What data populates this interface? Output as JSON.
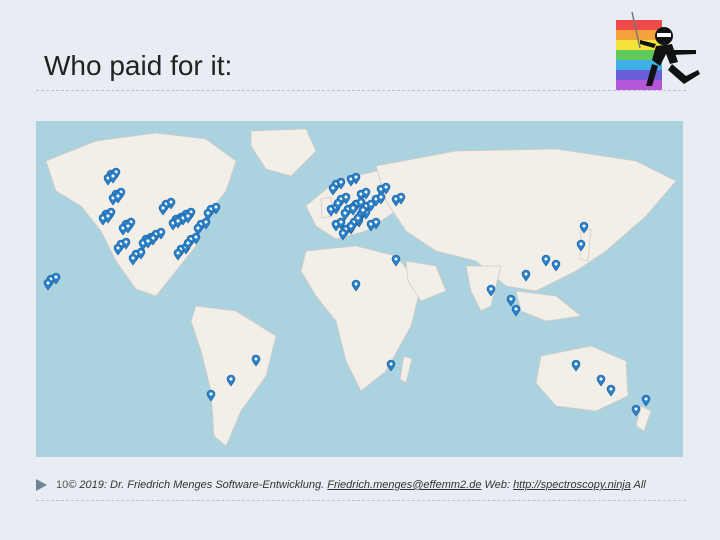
{
  "slide": {
    "title": "Who paid for it:"
  },
  "footer": {
    "page_number": "10",
    "copyright": "© 2019:  Dr. Friedrich Menges Software-Entwicklung.",
    "email": "Friedrich.menges@effemm2.de",
    "web_label": " Web: ",
    "web_url": "http://spectroscopy.ninja",
    "trailing": " All"
  },
  "map": {
    "marker_color": "#2a81cb",
    "land_color": "#f2efe9",
    "water_color": "#aad3df",
    "marker_groups": [
      {
        "region": "North America",
        "count": 55
      },
      {
        "region": "Europe",
        "count": 40
      },
      {
        "region": "Asia",
        "count": 9
      },
      {
        "region": "Oceania",
        "count": 5
      },
      {
        "region": "South America",
        "count": 3
      },
      {
        "region": "Africa",
        "count": 2
      }
    ]
  },
  "logo": {
    "name": "ninja-logo-icon",
    "stripe_colors": [
      "#ef4b4b",
      "#f6a23a",
      "#f5e33b",
      "#5fc95a",
      "#3fb0e6",
      "#6a5fd8",
      "#b457d9"
    ]
  }
}
